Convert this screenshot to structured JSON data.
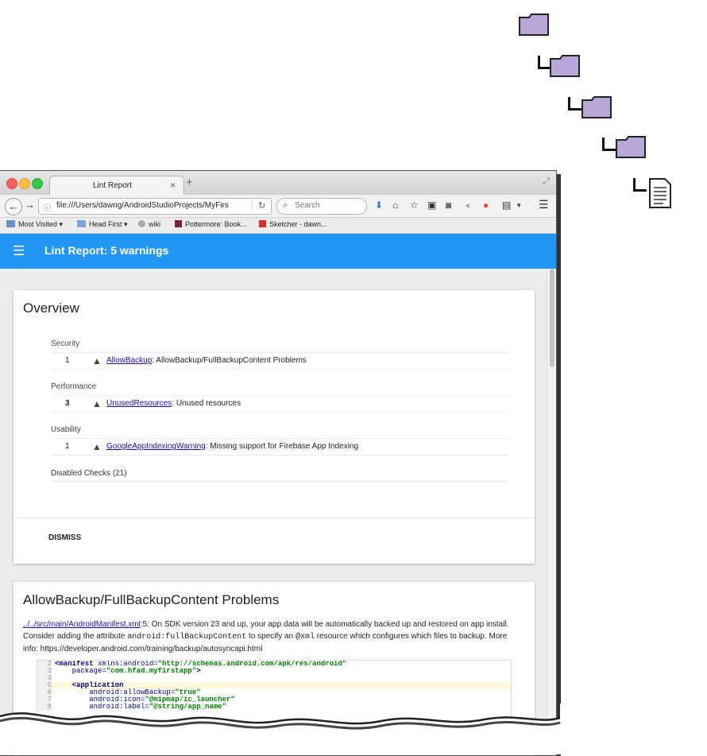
{
  "browser": {
    "tab_title": "Lint Report",
    "tab_close": "×",
    "new_tab": "+",
    "url": "file:///Users/dawng/AndroidStudioProjects/MyFirs",
    "search_placeholder": "Search",
    "bookmarks": [
      {
        "label": "Most Visited ▾",
        "icon": "gear-folder-icon"
      },
      {
        "label": "Head First ▾",
        "icon": "folder-icon"
      },
      {
        "label": "wiki",
        "icon": "globe-icon"
      },
      {
        "label": "Pottermore: Book...",
        "icon": "pottermore-icon"
      },
      {
        "label": "Sketcher - dawn...",
        "icon": "gmail-icon"
      }
    ]
  },
  "report": {
    "title": "Lint Report: 5 warnings",
    "overview": {
      "title": "Overview",
      "categories": [
        {
          "name": "Security",
          "count": "1",
          "link": "AllowBackup",
          "text": ": AllowBackup/FullBackupContent Problems"
        },
        {
          "name": "Performance",
          "count": "3",
          "link": "UnusedResources",
          "text": ": Unused resources"
        },
        {
          "name": "Usability",
          "count": "1",
          "link": "GoogleAppIndexingWarning",
          "text": ": Missing support for Firebase App Indexing"
        }
      ],
      "disabled": "Disabled Checks (21)",
      "dismiss": "DISMISS"
    },
    "issue": {
      "title": "AllowBackup/FullBackupContent Problems",
      "location_link": "../../src/main/AndroidManifest.xml",
      "location_rest": ":5: On SDK version 23 and up, your app data will be automatically backed up and restored on app install. Consider adding the attribute ",
      "attr_code": "android:fullBackupContent",
      "desc_mid": " to specify an ",
      "xml_code": "@xml",
      "desc_end": " resource which configures which files to backup. More info: https://developer.android.com/training/backup/autosyncapi.html",
      "code": [
        {
          "ln": "2",
          "tag": "<manifest",
          "attr": " xmlns:android=",
          "val": "\"http://schemas.android.com/apk/res/android\"",
          "tail": ""
        },
        {
          "ln": "3",
          "tag": "",
          "attr": "    package=",
          "val": "\"com.hfad.myfirstapp\"",
          "tail": ">"
        },
        {
          "ln": "4",
          "tag": "",
          "attr": "",
          "val": "",
          "tail": ""
        },
        {
          "ln": "5",
          "tag": "    <application",
          "attr": "",
          "val": "",
          "tail": ""
        },
        {
          "ln": "6",
          "tag": "",
          "attr": "        android:allowBackup=",
          "val": "\"true\"",
          "tail": ""
        },
        {
          "ln": "7",
          "tag": "",
          "attr": "        android:icon=",
          "val": "\"@mipmap/ic_launcher\"",
          "tail": ""
        },
        {
          "ln": "8",
          "tag": "",
          "attr": "        android:label=",
          "val": "\"@string/app_name\"",
          "tail": ""
        }
      ]
    }
  },
  "colors": {
    "appbar": "#2196f3",
    "folder": "#b7a6d8",
    "link": "#1a0dab"
  }
}
